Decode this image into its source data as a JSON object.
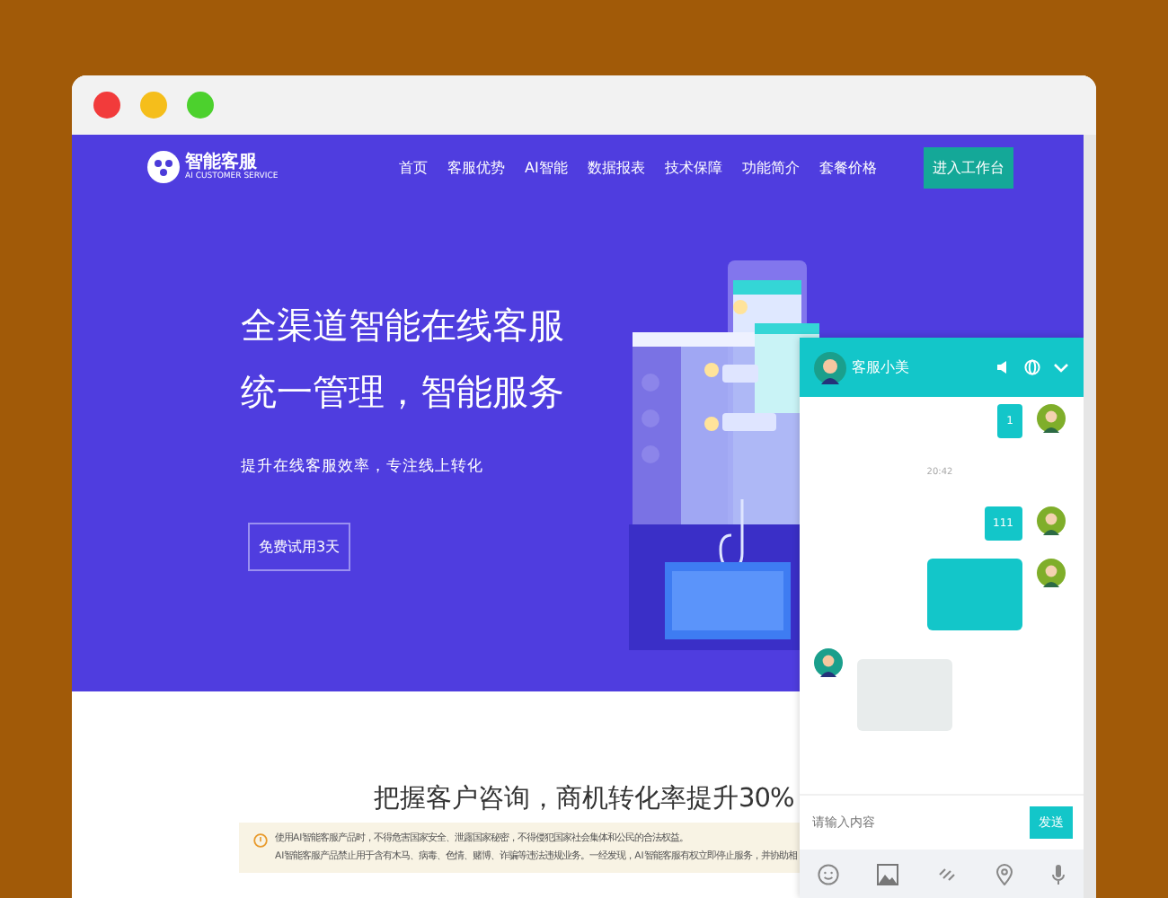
{
  "logo": {
    "name": "智能客服",
    "tagline": "AI CUSTOMER SERVICE"
  },
  "nav": {
    "items": [
      "首页",
      "客服优势",
      "AI智能",
      "数据报表",
      "技术保障",
      "功能简介",
      "套餐价格"
    ],
    "cta": "进入工作台"
  },
  "hero": {
    "title_lines": [
      "全渠道智能在线客服",
      "统一管理，智能服务"
    ],
    "subtitle": "提升在线客服效率，专注线上转化",
    "button": "免费试用3天"
  },
  "section": {
    "title": "把握客户咨询，商机转化率提升30%"
  },
  "notice": {
    "lines": [
      "使用AI智能客服产品时，不得危害国家安全、泄露国家秘密，不得侵犯国家社会集体和公民的合法权益。",
      "AI智能客服产品禁止用于含有木马、病毒、色情、赌博、诈骗等违法违规业务。一经发现，AI智能客服有权立即停止服务，并协助相"
    ]
  },
  "chat": {
    "agent_name": "客服小美",
    "messages": [
      {
        "kind": "user-text",
        "text": "1"
      },
      {
        "kind": "time",
        "text": "20:42"
      },
      {
        "kind": "user-text",
        "text": "111"
      },
      {
        "kind": "user-image"
      },
      {
        "kind": "agent-image"
      }
    ],
    "input": {
      "placeholder": "请输入内容"
    },
    "send": "发送"
  }
}
